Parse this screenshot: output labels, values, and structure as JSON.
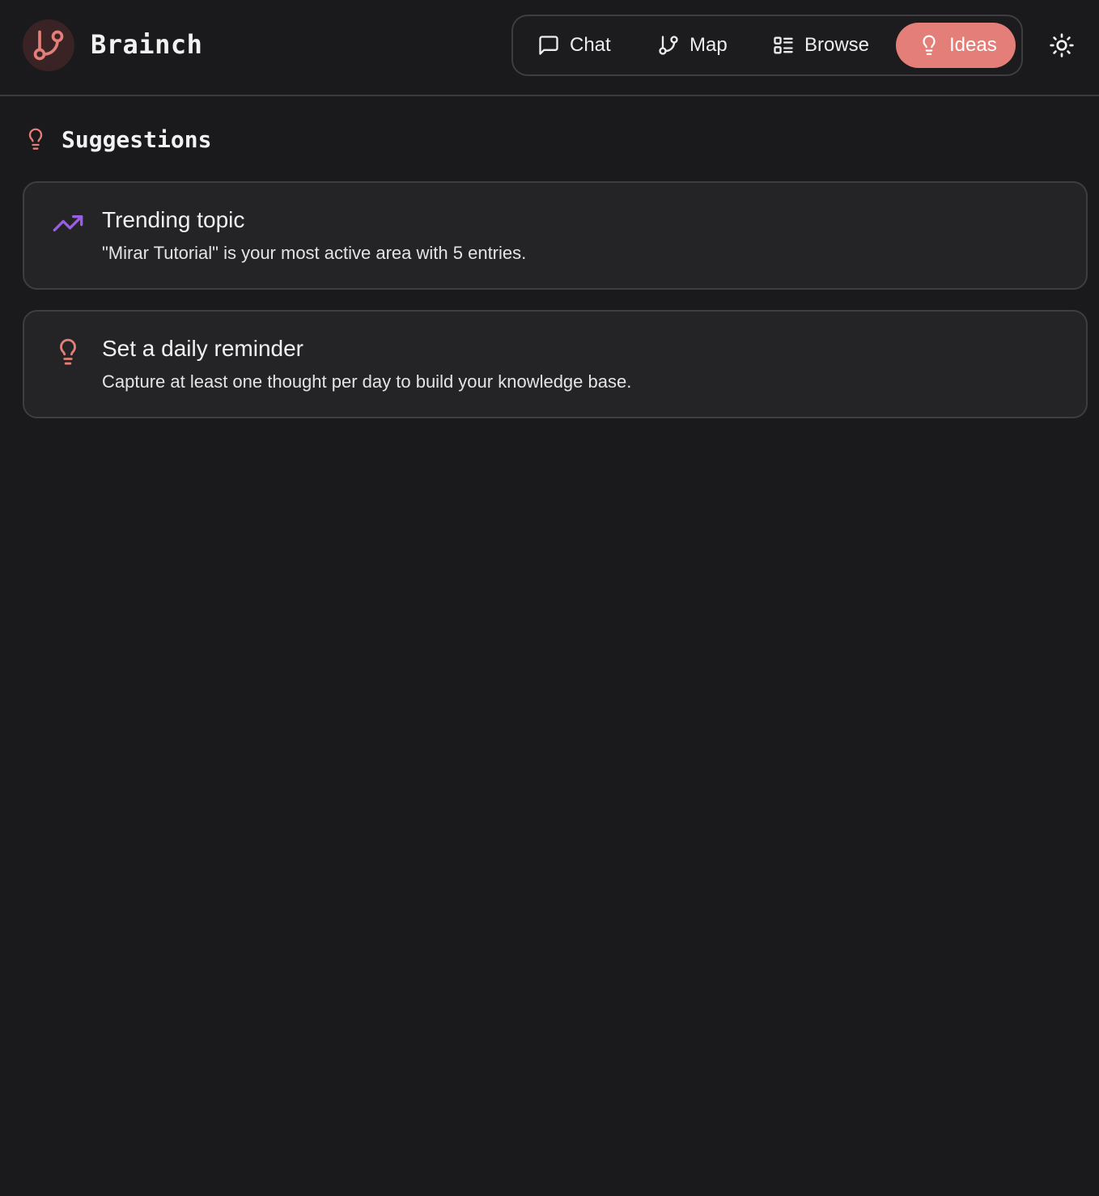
{
  "app": {
    "title": "Brainch",
    "accent_color": "#e37f78",
    "logo_icon": "git-branch-icon"
  },
  "nav": {
    "items": [
      {
        "label": "Chat",
        "icon": "message-square-icon",
        "active": false
      },
      {
        "label": "Map",
        "icon": "git-branch-icon",
        "active": false
      },
      {
        "label": "Browse",
        "icon": "list-icon",
        "active": true
      },
      {
        "label": "Ideas",
        "icon": "lightbulb-icon",
        "active": true
      }
    ],
    "theme_toggle_icon": "sun-icon"
  },
  "suggestions": {
    "title": "Suggestions",
    "icon": "lightbulb-icon",
    "cards": [
      {
        "title": "Trending topic",
        "description": "\"Mirar Tutorial\" is your most active area with 5 entries.",
        "icon": "trending-up-icon",
        "icon_color": "#9b5de5"
      },
      {
        "title": "Set a daily reminder",
        "description": "Capture at least one thought per day to build your knowledge base.",
        "icon": "lightbulb-icon",
        "icon_color": "#e37f78"
      }
    ]
  }
}
